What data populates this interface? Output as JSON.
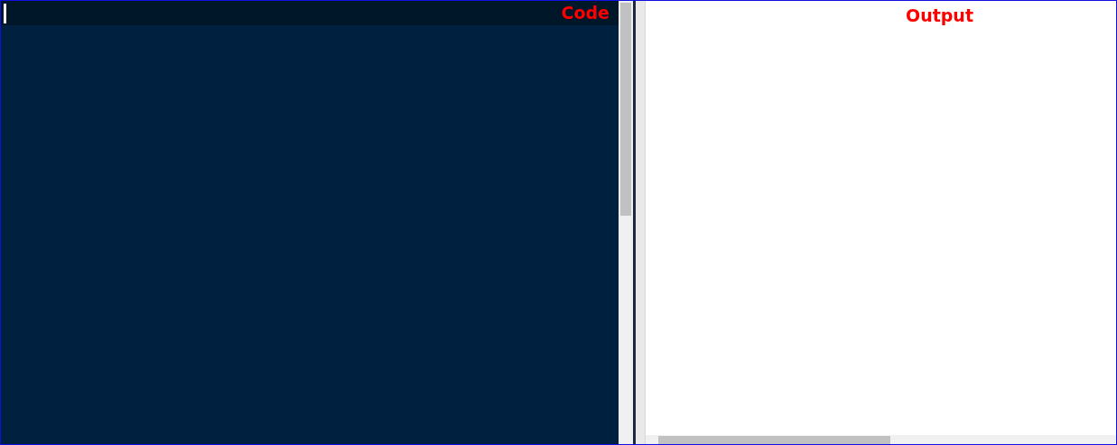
{
  "panes": [
    {
      "kind": "code",
      "label": "Code"
    },
    {
      "kind": "output",
      "label": "Output"
    }
  ]
}
